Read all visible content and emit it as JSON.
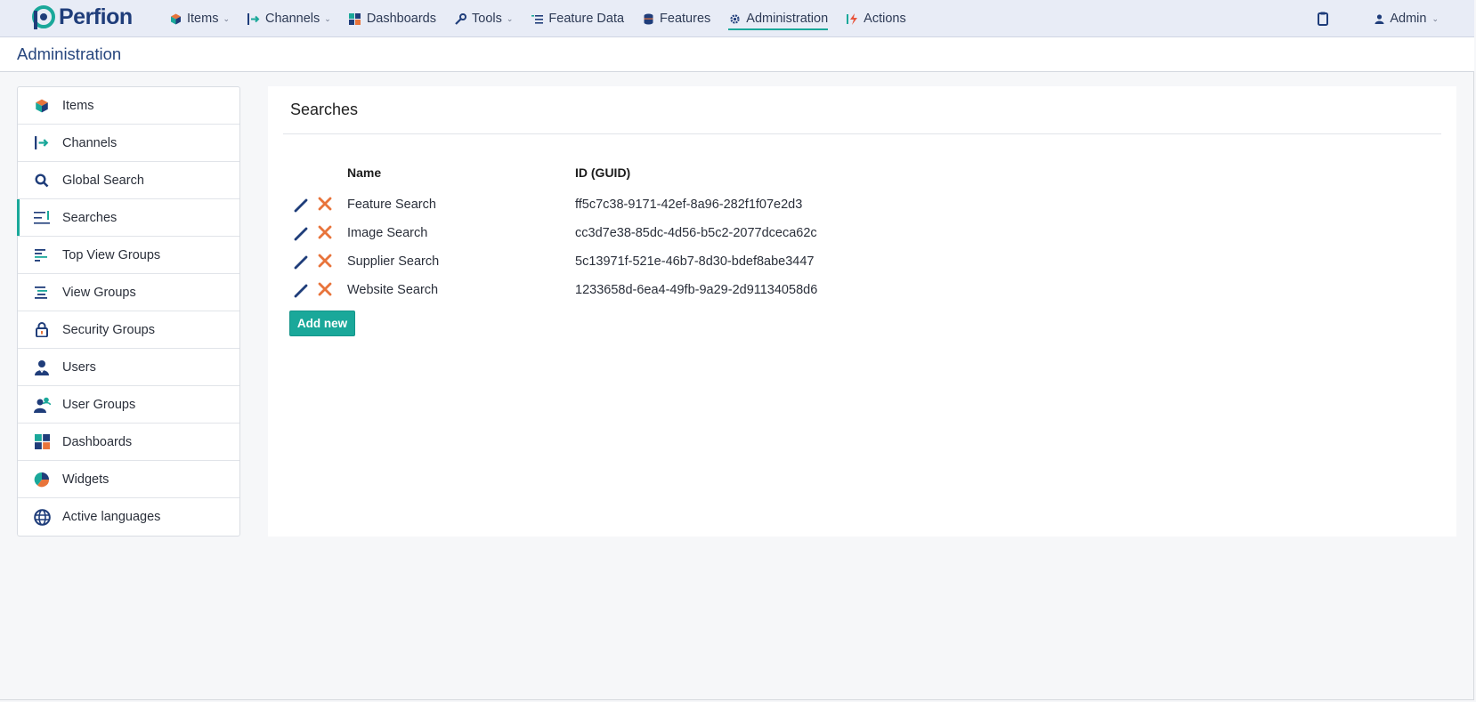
{
  "brand": {
    "name": "Perfion"
  },
  "nav": {
    "items": [
      {
        "label": "Items",
        "icon": "cube-icon",
        "dropdown": true
      },
      {
        "label": "Channels",
        "icon": "channel-arrow-icon",
        "dropdown": true
      },
      {
        "label": "Dashboards",
        "icon": "dashboard-grid-icon",
        "dropdown": false
      },
      {
        "label": "Tools",
        "icon": "wrench-icon",
        "dropdown": true
      },
      {
        "label": "Feature Data",
        "icon": "list-icon",
        "dropdown": false
      },
      {
        "label": "Features",
        "icon": "database-icon",
        "dropdown": false
      },
      {
        "label": "Administration",
        "icon": "gear-icon",
        "dropdown": false,
        "active": true
      },
      {
        "label": "Actions",
        "icon": "bolt-icon",
        "dropdown": false
      }
    ],
    "user_label": "Admin"
  },
  "page": {
    "title": "Administration"
  },
  "sidebar": {
    "items": [
      {
        "label": "Items",
        "icon": "cube-icon"
      },
      {
        "label": "Channels",
        "icon": "channel-arrow-icon"
      },
      {
        "label": "Global Search",
        "icon": "search-icon"
      },
      {
        "label": "Searches",
        "icon": "searches-list-icon",
        "active": true
      },
      {
        "label": "Top View Groups",
        "icon": "top-view-groups-icon"
      },
      {
        "label": "View Groups",
        "icon": "view-groups-icon"
      },
      {
        "label": "Security Groups",
        "icon": "lock-icon"
      },
      {
        "label": "Users",
        "icon": "user-icon"
      },
      {
        "label": "User Groups",
        "icon": "user-group-icon"
      },
      {
        "label": "Dashboards",
        "icon": "dashboard-grid-icon"
      },
      {
        "label": "Widgets",
        "icon": "pie-chart-icon"
      },
      {
        "label": "Active languages",
        "icon": "globe-icon"
      }
    ]
  },
  "main": {
    "title": "Searches",
    "table": {
      "columns": [
        "Name",
        "ID (GUID)"
      ],
      "rows": [
        {
          "name": "Feature Search",
          "guid": "ff5c7c38-9171-42ef-8a96-282f1f07e2d3"
        },
        {
          "name": "Image Search",
          "guid": "cc3d7e38-85dc-4d56-b5c2-2077dceca62c"
        },
        {
          "name": "Supplier Search",
          "guid": "5c13971f-521e-46b7-8d30-bdef8abe3447"
        },
        {
          "name": "Website Search",
          "guid": "1233658d-6ea4-49fb-9a29-2d91134058d6"
        }
      ]
    },
    "add_button_label": "Add new"
  },
  "colors": {
    "accent": "#1aa89a",
    "brand": "#1f3d7a",
    "delete": "#e8743b",
    "edit": "#1f3d7a"
  }
}
